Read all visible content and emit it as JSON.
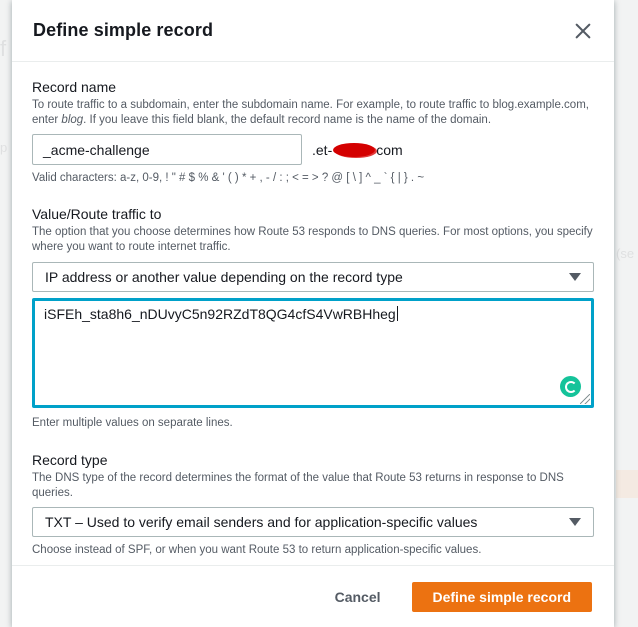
{
  "modal": {
    "title": "Define simple record",
    "record_name": {
      "label": "Record name",
      "desc_pre": "To route traffic to a subdomain, enter the subdomain name. For example, to route traffic to blog.example.com, enter ",
      "desc_em": "blog",
      "desc_post": ". If you leave this field blank, the default record name is the name of the domain.",
      "value": "_acme-challenge",
      "suffix_pre": ".et-",
      "suffix_post": "com",
      "hint": "Valid characters: a-z, 0-9, ! \" # $ % & ' ( ) * + , - / : ; < = > ? @ [ \\ ] ^ _ ` { | } . ~"
    },
    "value_route": {
      "label": "Value/Route traffic to",
      "desc": "The option that you choose determines how Route 53 responds to DNS queries. For most options, you specify where you want to route internet traffic.",
      "select_value": "IP address or another value depending on the record type",
      "textarea_value": "iSFEh_sta8h6_nDUvyC5n92RZdT8QG4cfS4VwRBHheg",
      "hint": "Enter multiple values on separate lines."
    },
    "record_type": {
      "label": "Record type",
      "desc": "The DNS type of the record determines the format of the value that Route 53 returns in response to DNS queries.",
      "select_value": "TXT – Used to verify email senders and for application-specific values",
      "hint": "Choose instead of SPF, or when you want Route 53 to return application-specific values."
    },
    "footer": {
      "cancel_label": "Cancel",
      "primary_label": "Define simple record"
    }
  },
  "colors": {
    "primary": "#ec7211",
    "focus": "#00a1c9",
    "grammarly": "#15c39a"
  },
  "icons": [
    "close-icon",
    "chevron-down-icon",
    "grammarly-icon",
    "resize-grip-icon"
  ]
}
